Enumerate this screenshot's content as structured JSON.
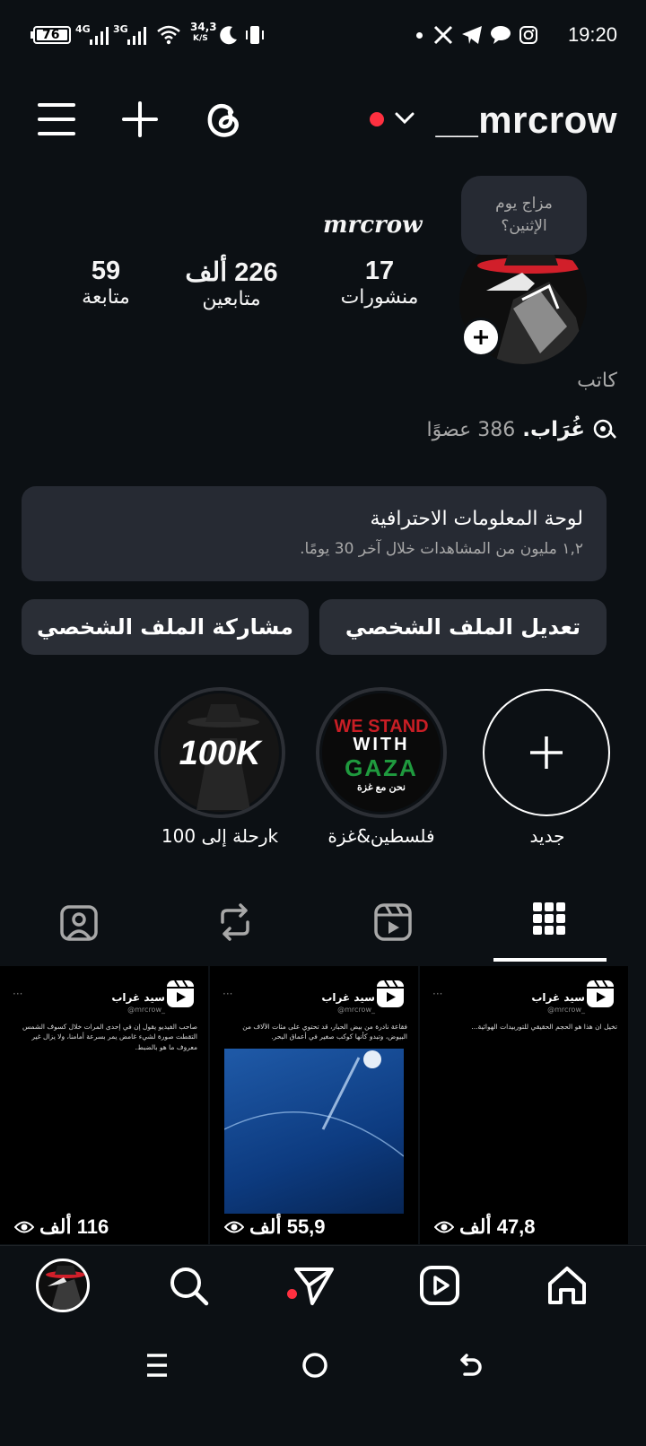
{
  "status_bar": {
    "battery": "76",
    "net1": "4G",
    "net2": "3G",
    "speed_top": "34,3",
    "speed_unit": "K/S",
    "time": "19:20"
  },
  "header": {
    "username": "__mrcrow"
  },
  "note_bubble": "مزاج يوم الإثنين؟",
  "profile": {
    "display_name": "mrcrow",
    "stats": [
      {
        "value": "17",
        "label": "منشورات"
      },
      {
        "value": "226 ألف",
        "label": "متابعين"
      },
      {
        "value": "59",
        "label": "متابعة"
      }
    ],
    "category": "كاتب",
    "channel_name": "غُرَاب.",
    "channel_members": "386 عضوًا"
  },
  "dashboard": {
    "title": "لوحة المعلومات الاحترافية",
    "subtitle": "١,٢ مليون من المشاهدات خلال آخر 30 يومًا."
  },
  "buttons": {
    "edit": "تعديل الملف الشخصي",
    "share": "مشاركة الملف الشخصي"
  },
  "highlights": [
    {
      "label": "جديد",
      "icon": "plus-icon"
    },
    {
      "label": "فلسطين&غزة",
      "cover_top": "WE STAND",
      "cover_mid": "WITH",
      "cover_bot": "GAZA",
      "cover_ar": "نحن مع غزة"
    },
    {
      "label": "رحلة إلى 100k",
      "cover_text": "100K"
    }
  ],
  "tabs": [
    {
      "name": "grid-tab-icon",
      "active": true
    },
    {
      "name": "reels-tab-icon",
      "active": false
    },
    {
      "name": "reposts-tab-icon",
      "active": false
    },
    {
      "name": "tagged-tab-icon",
      "active": false
    }
  ],
  "posts": [
    {
      "views": "47,8 ألف",
      "author": "سيد غراب",
      "handle": "@mrcrow_",
      "text": "تخيل ان هذا هو الحجم الحقيقي للتوربيدات الهوائية..."
    },
    {
      "views": "55,9 ألف",
      "author": "سيد غراب",
      "handle": "@mrcrow_",
      "text": "فقاعة نادرة من بيض الحبار، قد تحتوي على مئات الآلاف من البيوض، وتبدو كأنها كوكب صغير في أعماق البحر."
    },
    {
      "views": "116 ألف",
      "author": "سيد غراب",
      "handle": "@mrcrow_",
      "text": "صاحب الفيديو يقول إن في إحدى المرات خلال كسوف الشمس التقطت صورة لشيء غامض يمر بسرعة أمامنا، ولا يزال غير معروف ما هو بالضبط."
    }
  ],
  "colors": {
    "background": "#0c1014",
    "notification_red": "#ff3040",
    "card": "#262a33"
  }
}
